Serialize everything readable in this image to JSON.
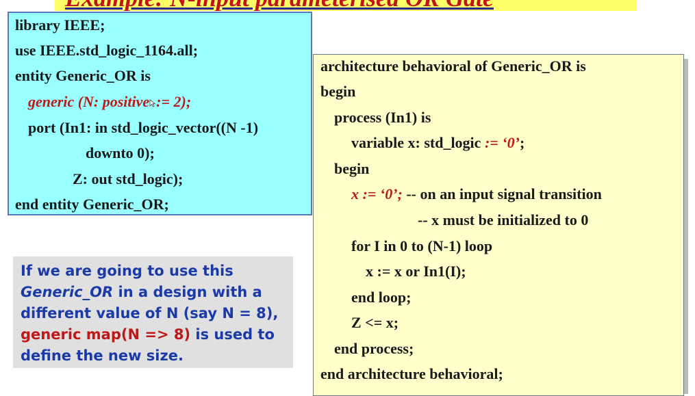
{
  "title": "Example: N-input parameterised OR Gate",
  "entity": {
    "l1": "library IEEE;",
    "l2": "use IEEE.std_logic_1164.all;",
    "l3": "entity Generic_OR is",
    "l4a": "generic (N: positive",
    "l4b": ":= 2);",
    "l5": "port (In1: in std_logic_vector((N -1)",
    "l6": "downto 0);",
    "l7": "Z: out std_logic);",
    "l8": "end entity Generic_OR;"
  },
  "arch": {
    "l1": "architecture behavioral of Generic_OR is",
    "l2": "begin",
    "l3": "process (In1) is",
    "l4a": "variable x: std_logic",
    "l4b": " := ‘0’",
    "l4c": ";",
    "l5": "begin",
    "l6a": "x := ‘0’;",
    "l6b": " -- on an input signal transition",
    "l7": "-- x must be initialized to 0",
    "l8": "for I in 0 to (N-1) loop",
    "l9": "x := x or In1(I);",
    "l10": "end loop;",
    "l11": "Z <= x;",
    "l12": "end process;",
    "l13": "end architecture behavioral;"
  },
  "note": {
    "l1": "If we are going to use this",
    "l2a": "Generic_OR",
    "l2b": " in a design with a",
    "l3": "different value of N (say N = 8),",
    "l4a": "generic map(N => 8)",
    "l4b": " is used to",
    "l5": "define the new size."
  },
  "icons": {
    "cursor": "mouse-pointer-icon"
  },
  "colors": {
    "entity_bg": "#99ffff",
    "arch_bg": "#ffffcc",
    "note_bg": "#e0e0e0",
    "title_bg": "#ffff66",
    "keyword_red": "#c01818",
    "note_blue": "#1a3aa8"
  }
}
